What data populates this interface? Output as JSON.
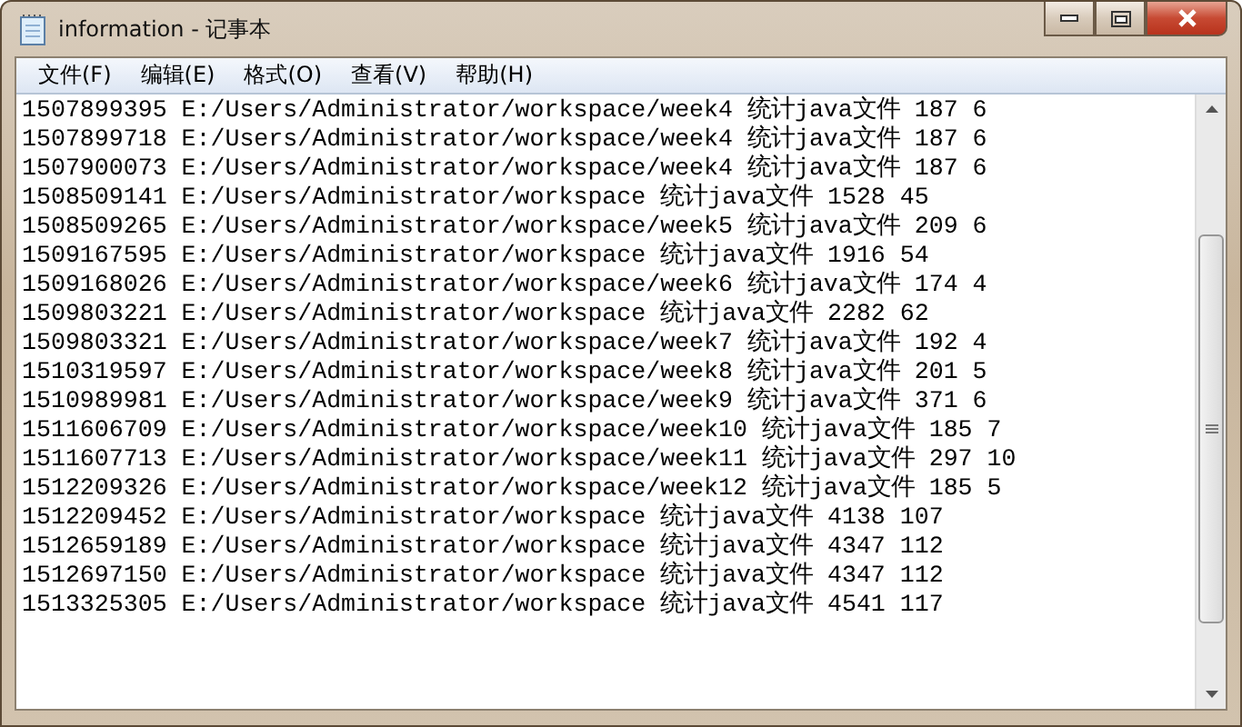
{
  "window": {
    "title": "information - 记事本"
  },
  "menu": [
    "文件(F)",
    "编辑(E)",
    "格式(O)",
    "查看(V)",
    "帮助(H)"
  ],
  "lines": [
    "1507899395 E:/Users/Administrator/workspace/week4 统计java文件 187 6",
    "1507899718 E:/Users/Administrator/workspace/week4 统计java文件 187 6",
    "1507900073 E:/Users/Administrator/workspace/week4 统计java文件 187 6",
    "1508509141 E:/Users/Administrator/workspace 统计java文件 1528 45",
    "1508509265 E:/Users/Administrator/workspace/week5 统计java文件 209 6",
    "1509167595 E:/Users/Administrator/workspace 统计java文件 1916 54",
    "1509168026 E:/Users/Administrator/workspace/week6 统计java文件 174 4",
    "1509803221 E:/Users/Administrator/workspace 统计java文件 2282 62",
    "1509803321 E:/Users/Administrator/workspace/week7 统计java文件 192 4",
    "1510319597 E:/Users/Administrator/workspace/week8 统计java文件 201 5",
    "1510989981 E:/Users/Administrator/workspace/week9 统计java文件 371 6",
    "1511606709 E:/Users/Administrator/workspace/week10 统计java文件 185 7",
    "1511607713 E:/Users/Administrator/workspace/week11 统计java文件 297 10",
    "1512209326 E:/Users/Administrator/workspace/week12 统计java文件 185 5",
    "1512209452 E:/Users/Administrator/workspace 统计java文件 4138 107",
    "1512659189 E:/Users/Administrator/workspace 统计java文件 4347 112",
    "1512697150 E:/Users/Administrator/workspace 统计java文件 4347 112",
    "1513325305 E:/Users/Administrator/workspace 统计java文件 4541 117"
  ]
}
